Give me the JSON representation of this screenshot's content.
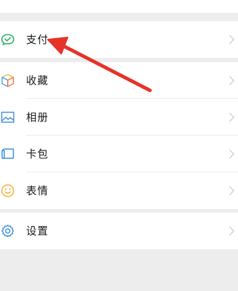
{
  "menu": {
    "pay": {
      "label": "支付",
      "icon": "wechat-pay-icon"
    },
    "favorites": {
      "label": "收藏",
      "icon": "favorites-cube-icon"
    },
    "album": {
      "label": "相册",
      "icon": "album-picture-icon"
    },
    "cards": {
      "label": "卡包",
      "icon": "card-wallet-icon"
    },
    "stickers": {
      "label": "表情",
      "icon": "smiley-face-icon"
    },
    "settings": {
      "label": "设置",
      "icon": "gear-icon"
    }
  },
  "colors": {
    "page_background": "#ededed",
    "row_background": "#ffffff",
    "pay_icon": "#2aae67",
    "favorites_icon_top": "#f2b73f",
    "favorites_icon_right": "#f07c4f",
    "favorites_icon_left": "#4ca7e6",
    "album_icon": "#4a90d9",
    "cards_icon": "#3d8fe0",
    "stickers_icon": "#f3b233",
    "settings_icon": "#3d8fe0",
    "annotation_arrow": "#e6332a"
  }
}
